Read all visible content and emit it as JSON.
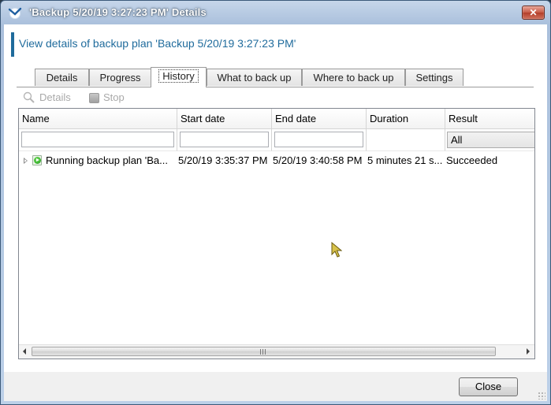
{
  "window": {
    "title": "'Backup 5/20/19 3:27:23 PM' Details",
    "close_glyph": "✕",
    "icon": "app-logo-icon"
  },
  "header": {
    "text": "View details of backup plan 'Backup 5/20/19 3:27:23 PM'",
    "accent_color": "#1f6b9c"
  },
  "tabs": [
    {
      "label": "Details",
      "active": false
    },
    {
      "label": "Progress",
      "active": false
    },
    {
      "label": "History",
      "active": true
    },
    {
      "label": "What to back up",
      "active": false
    },
    {
      "label": "Where to back up",
      "active": false
    },
    {
      "label": "Settings",
      "active": false
    }
  ],
  "toolbar": {
    "details_label": "Details",
    "details_icon": "magnifier-icon",
    "stop_label": "Stop",
    "stop_icon": "stop-icon",
    "enabled": false
  },
  "grid": {
    "columns": [
      "Name",
      "Start date",
      "End date",
      "Duration",
      "Result"
    ],
    "filters": {
      "name": "",
      "start_date": "",
      "end_date": "",
      "result": "All"
    },
    "rows": [
      {
        "name": "Running backup plan 'Ba...",
        "start_date": "5/20/19 3:35:37 PM",
        "end_date": "5/20/19 3:40:58 PM",
        "duration": "5 minutes 21 s...",
        "result": "Succeeded",
        "status_icon": "running-play-icon"
      }
    ]
  },
  "footer": {
    "close_label": "Close"
  }
}
